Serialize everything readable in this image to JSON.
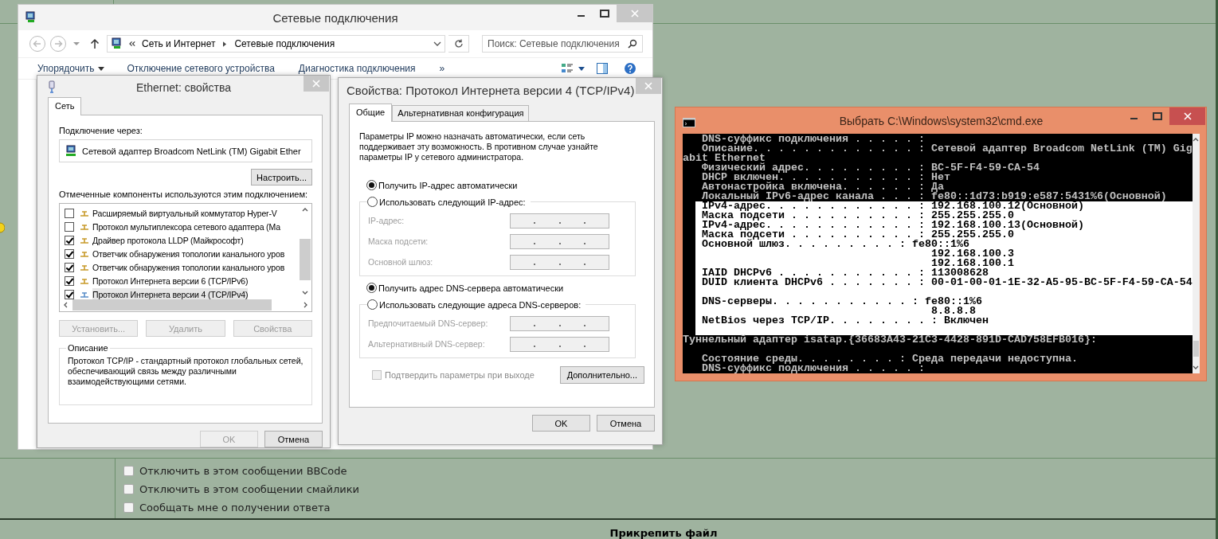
{
  "explorer": {
    "title": "Сетевые подключения",
    "breadcrumb": [
      "Сеть и Интернет",
      "Сетевые подключения"
    ],
    "search": {
      "placeholder": "Поиск: Сетевые подключения"
    },
    "toolbar": [
      {
        "label": "Упорядочить",
        "kind": "menu"
      },
      {
        "label": "Отключение сетевого устройства",
        "kind": "command"
      },
      {
        "label": "Диагностика подключения",
        "kind": "command"
      },
      {
        "label": "»",
        "kind": "more"
      }
    ]
  },
  "ethernet_dialog": {
    "title": "Ethernet: свойства",
    "tabs": [
      {
        "label": "Сеть",
        "selected": true
      }
    ],
    "connect_via_label": "Подключение через:",
    "adapter": "Сетевой адаптер Broadcom NetLink (TM) Gigabit Ether",
    "configure_button": "Настроить...",
    "components_label": "Отмеченные компоненты используются этим подключением:",
    "components": [
      {
        "label": "Расширяемый виртуальный коммутатор Hyper-V",
        "checked": false,
        "selected": false
      },
      {
        "label": "Протокол мультиплексора сетевого адаптера (Ма",
        "checked": false,
        "selected": false
      },
      {
        "label": "Драйвер протокола LLDP (Майкрософт)",
        "checked": true,
        "selected": false
      },
      {
        "label": "Ответчик обнаружения топологии канального уров",
        "checked": true,
        "selected": false
      },
      {
        "label": "Ответчик обнаружения топологии канального уров",
        "checked": true,
        "selected": false
      },
      {
        "label": "Протокол Интернета версии 6 (TCP/IPv6)",
        "checked": true,
        "selected": false
      },
      {
        "label": "Протокол Интернета версии 4 (TCP/IPv4)",
        "checked": true,
        "selected": true
      }
    ],
    "actions": [
      {
        "label": "Установить...",
        "disabled": true
      },
      {
        "label": "Удалить",
        "disabled": true
      },
      {
        "label": "Свойства",
        "disabled": true
      }
    ],
    "description": {
      "title": "Описание",
      "text": "Протокол TCP/IP - стандартный протокол глобальных сетей, обеспечивающий связь между различными взаимодействующими сетями."
    },
    "footer_buttons": [
      {
        "label": "OK",
        "disabled": true
      },
      {
        "label": "Отмена",
        "disabled": false
      }
    ]
  },
  "ipv4_dialog": {
    "title": "Свойства: Протокол Интернета версии 4 (TCP/IPv4)",
    "tabs": [
      {
        "label": "Общие",
        "selected": true
      },
      {
        "label": "Альтернативная конфигурация",
        "selected": false
      }
    ],
    "intro": "Параметры IP можно назначать автоматически, если сеть поддерживает эту возможность. В противном случае узнайте параметры IP у сетевого администратора.",
    "sections": [
      {
        "radios": [
          {
            "label": "Получить IP-адрес автоматически",
            "selected": true
          },
          {
            "label": "Использовать следующий IP-адрес:",
            "selected": false
          }
        ],
        "fields": [
          {
            "label": "IP-адрес:"
          },
          {
            "label": "Маска подсети:"
          },
          {
            "label": "Основной шлюз:"
          }
        ]
      },
      {
        "radios": [
          {
            "label": "Получить адрес DNS-сервера автоматически",
            "selected": true
          },
          {
            "label": "Использовать следующие адреса DNS-серверов:",
            "selected": false
          }
        ],
        "fields": [
          {
            "label": "Предпочитаемый DNS-сервер:"
          },
          {
            "label": "Альтернативный DNS-сервер:"
          }
        ]
      }
    ],
    "validate": {
      "label": "Подтвердить параметры при выходе",
      "checked": false,
      "disabled": true
    },
    "advanced_button": "Дополнительно...",
    "footer_buttons": [
      {
        "label": "OK",
        "disabled": false
      },
      {
        "label": "Отмена",
        "disabled": false
      }
    ]
  },
  "cmd": {
    "title": "Выбрать C:\\Windows\\system32\\cmd.exe",
    "lines": [
      {
        "kind": "text",
        "text": "   DNS-суффикс подключения . . . . . :",
        "selected": false
      },
      {
        "kind": "text",
        "text": "   Описание. . . . . . . . . . . . . : Сетевой адаптер Broadcom NetLink (TM) Gig",
        "selected": false
      },
      {
        "kind": "text",
        "text": "abit Ethernet",
        "selected": false
      },
      {
        "kind": "text",
        "text": "   Физический адрес. . . . . . . . . : BC-5F-F4-59-CA-54",
        "selected": false
      },
      {
        "kind": "text",
        "text": "   DHCP включен. . . . . . . . . . . : Нет",
        "selected": false
      },
      {
        "kind": "text",
        "text": "   Автонастройка включена. . . . . . : Да",
        "selected": false
      },
      {
        "kind": "text",
        "text": "   Локальный IPv6-адрес канала . . . : fe80::1d73:b919:e587:5431%6(Основной)",
        "selected": false
      },
      {
        "kind": "text",
        "text": "   IPv4-адрес. . . . . . . . . . . . : 192.168.100.12(Основной)",
        "selected": true
      },
      {
        "kind": "text",
        "text": "   Маска подсети . . . . . . . . . . : 255.255.255.0",
        "selected": true
      },
      {
        "kind": "text",
        "text": "   IPv4-адрес. . . . . . . . . . . . : 192.168.100.13(Основной)",
        "selected": true
      },
      {
        "kind": "text",
        "text": "   Маска подсети . . . . . . . . . . : 255.255.255.0",
        "selected": true
      },
      {
        "kind": "text",
        "text": "   Основной шлюз. . . . . . . . . : fe80::1%6",
        "selected": true
      },
      {
        "kind": "text",
        "text": "                                       192.168.100.3",
        "selected": true
      },
      {
        "kind": "text",
        "text": "                                       192.168.100.1",
        "selected": true
      },
      {
        "kind": "text",
        "text": "   IAID DHCPv6 . . . . . . . . . . . : 113008628",
        "selected": true
      },
      {
        "kind": "text",
        "text": "   DUID клиента DHCPv6 . . . . . . . : 00-01-00-01-1E-32-A5-95-BC-5F-F4-59-CA-54",
        "selected": true
      },
      {
        "kind": "blank",
        "selected": true
      },
      {
        "kind": "text",
        "text": "   DNS-серверы. . . . . . . . . . . : fe80::1%6",
        "selected": true
      },
      {
        "kind": "text",
        "text": "                                       8.8.8.8",
        "selected": true
      },
      {
        "kind": "text",
        "text": "   NetBios через TCP/IP. . . . . . . . : Включен",
        "selected": true
      },
      {
        "kind": "blank",
        "selected": true
      },
      {
        "kind": "text",
        "text": "Туннельный адаптер isatap.{36683A43-21C3-4428-891D-CAD758EFB016}:",
        "selected": false
      },
      {
        "kind": "blank",
        "selected": false
      },
      {
        "kind": "text",
        "text": "   Состояние среды. . . . . . . . : Среда передачи недоступна.",
        "selected": false
      },
      {
        "kind": "text",
        "text": "   DNS-суффикс подключения . . . . . :",
        "selected": false
      }
    ]
  },
  "forum": {
    "options": [
      {
        "label": "Отключить в этом сообщении BBCode",
        "checked": false
      },
      {
        "label": "Отключить в этом сообщении смайлики",
        "checked": false
      },
      {
        "label": "Сообщать мне о получении ответа",
        "checked": false
      }
    ],
    "heading": "Прикрепить файл"
  }
}
